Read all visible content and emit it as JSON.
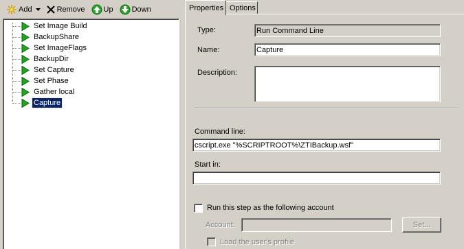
{
  "toolbar": {
    "add_label": "Add",
    "remove_label": "Remove",
    "up_label": "Up",
    "down_label": "Down"
  },
  "tree": {
    "items": [
      {
        "label": "Set Image Build"
      },
      {
        "label": "BackupShare"
      },
      {
        "label": "Set ImageFlags"
      },
      {
        "label": "BackupDir"
      },
      {
        "label": "Set Capture"
      },
      {
        "label": "Set Phase"
      },
      {
        "label": "Gather local"
      },
      {
        "label": "Capture",
        "selected": true
      }
    ]
  },
  "tabs": [
    {
      "label": "Properties",
      "active": true
    },
    {
      "label": "Options",
      "active": false
    }
  ],
  "properties": {
    "type_label": "Type:",
    "type_value": "Run Command Line",
    "name_label": "Name:",
    "name_value": "Capture",
    "description_label": "Description:",
    "description_value": "",
    "command_line_label": "Command line:",
    "command_line_value": "cscript.exe \"%SCRIPTROOT%\\ZTIBackup.wsf\"",
    "start_in_label": "Start in:",
    "start_in_value": "",
    "run_as_label": "Run this step as the following account",
    "run_as_checked": false,
    "account_label": "Account:",
    "account_value": "",
    "set_button_label": "Set...",
    "load_profile_label": "Load the user's profile",
    "load_profile_checked": false
  },
  "colors": {
    "window_bg": "#d4d0c8",
    "selection_bg": "#0a246a",
    "run_icon_green": "#1fa81f"
  },
  "icons": {
    "add": "star-burst-icon",
    "remove": "x-icon",
    "up": "green-circle-up-arrow-icon",
    "down": "green-circle-down-arrow-icon",
    "step": "green-play-triangle-icon"
  }
}
